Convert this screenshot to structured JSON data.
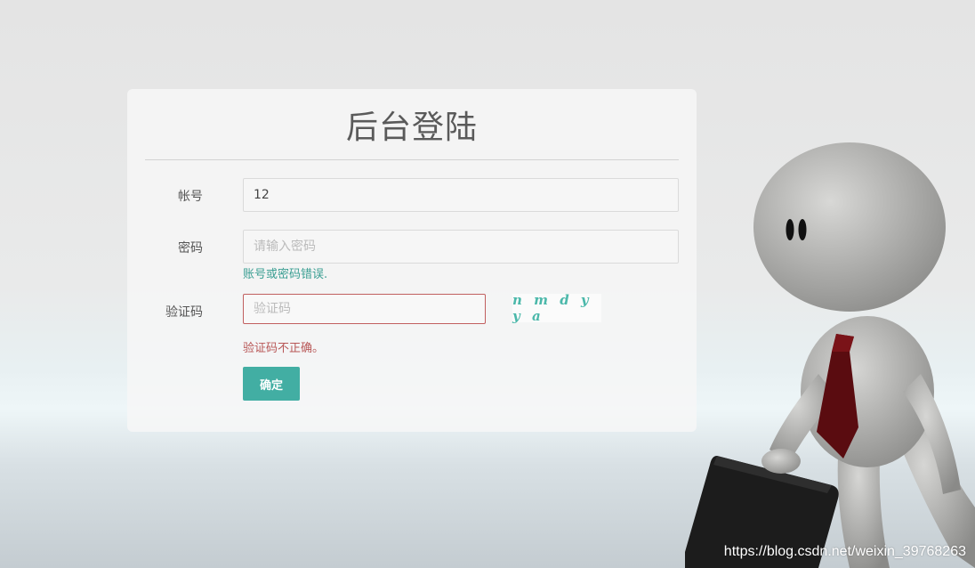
{
  "login": {
    "title": "后台登陆",
    "account": {
      "label": "帐号",
      "value": "12",
      "placeholder": ""
    },
    "password": {
      "label": "密码",
      "value": "",
      "placeholder": "请输入密码",
      "message": "账号或密码错误."
    },
    "captcha": {
      "label": "验证码",
      "value": "",
      "placeholder": "验证码",
      "code": "nmdyya",
      "message": "验证码不正确。"
    },
    "submit_label": "确定"
  },
  "colors": {
    "accent": "#42aea3",
    "success_text": "#3a9e92",
    "error_text": "#b85757",
    "error_border": "#c15f5f"
  },
  "illustration": {
    "name": "businessman-figure-icon"
  },
  "watermark": "https://blog.csdn.net/weixin_39768263"
}
